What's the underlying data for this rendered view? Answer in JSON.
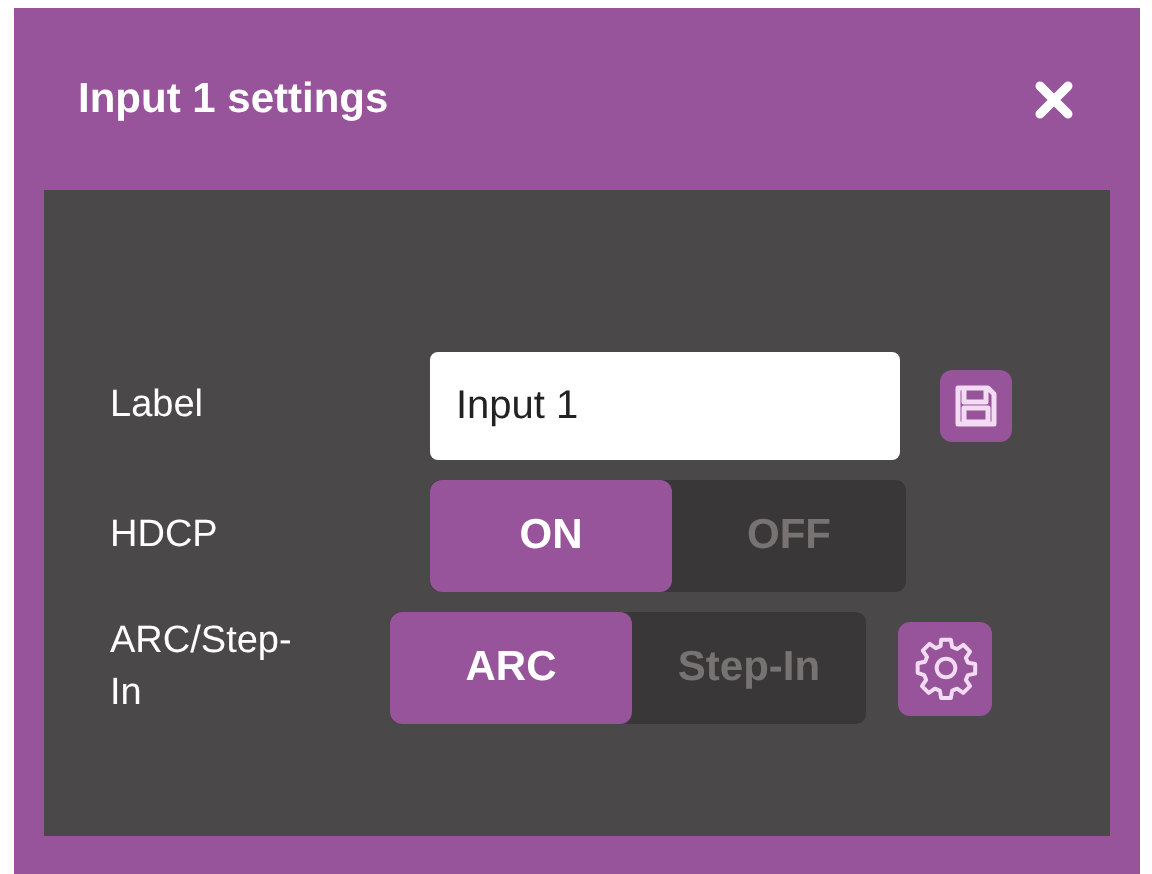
{
  "window": {
    "title": "Input 1 settings"
  },
  "rows": [
    {
      "kind": "text",
      "label": "Label",
      "value": "Input 1"
    },
    {
      "kind": "toggle",
      "label": "HDCP",
      "options": [
        {
          "label": "ON",
          "selected": true
        },
        {
          "label": "OFF",
          "selected": false
        }
      ]
    },
    {
      "kind": "toggle_settings",
      "label": "ARC/Step-In",
      "options": [
        {
          "label": "ARC",
          "selected": true
        },
        {
          "label": "Step-In",
          "selected": false
        }
      ]
    }
  ]
}
